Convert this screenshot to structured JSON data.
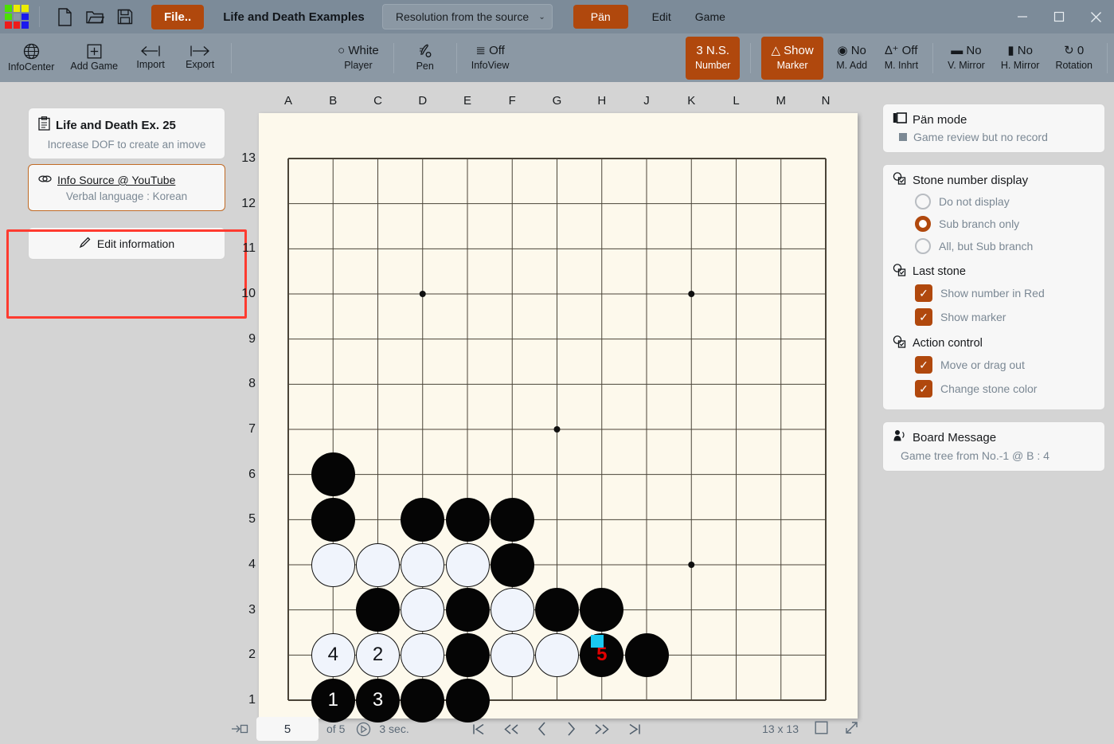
{
  "titlebar": {
    "new_icon": "new-file-icon",
    "open_icon": "open-folder-icon",
    "save_icon": "save-disk-icon",
    "file_button": "File..",
    "app_title": "Life and Death Examples",
    "collection_value": "Resolution from the source",
    "collection_arrow": "⌄",
    "mode_button": "Pän",
    "menu_edit": "Edit",
    "menu_game": "Game",
    "minimize": "–",
    "maximize": "☐",
    "close": "✕",
    "logo_colors": [
      "#4ce000",
      "#ecec00",
      "#ecec00",
      "#4ce000",
      "#8b98a4",
      "#1a1aee",
      "#ee1a1a",
      "#ee1a1a",
      "#1a1aee"
    ]
  },
  "ribbon": {
    "items": [
      {
        "glyph": "⊕",
        "label": "InfoCenter",
        "name": "infocenter"
      },
      {
        "glyph": "⊞",
        "label": "Add Game",
        "name": "add-game"
      },
      {
        "glyph": "⟵",
        "label": "Import",
        "name": "import"
      },
      {
        "glyph": "⟶",
        "label": "Export",
        "name": "export"
      }
    ],
    "mid_items": [
      {
        "glyph": "○ White",
        "label": "Player",
        "name": "white-player"
      },
      {
        "glyph": "✐",
        "label": "Pen",
        "name": "pen"
      },
      {
        "glyph": "≣ Off",
        "label": "InfoView",
        "name": "infoview"
      }
    ],
    "right_items": [
      {
        "glyph": "3 N.S.",
        "label": "Number",
        "name": "ns-number",
        "active": true
      },
      {
        "glyph": "△ Show",
        "label": "Marker",
        "name": "show-marker",
        "active": true
      },
      {
        "glyph": "◉ No",
        "label": "M. Add",
        "name": "m-add",
        "active": false
      },
      {
        "glyph": "∆⁺ Off",
        "label": "M. Inhrt",
        "name": "m-inhrt",
        "active": false
      },
      {
        "glyph": "▬ No",
        "label": "V. Mirror",
        "name": "v-mirror",
        "active": false
      },
      {
        "glyph": "▮ No",
        "label": "H. Mirror",
        "name": "h-mirror",
        "active": false
      },
      {
        "glyph": "↻ 0",
        "label": "Rotation",
        "name": "rotation",
        "active": false
      }
    ]
  },
  "left_panel": {
    "info_card": {
      "icon": "clipboard-icon",
      "title": "Life and Death Ex. 25",
      "subtitle": "Increase DOF to create an imove"
    },
    "source_card": {
      "icon": "link-icon",
      "link_text": "Info Source @ YouTube",
      "sub_text": "Verbal language : Korean"
    },
    "edit_card": {
      "icon": "pencil-icon",
      "label": "Edit information"
    }
  },
  "right_panel": {
    "mode_card": {
      "icon": "layers-icon",
      "title": "Pän mode",
      "note": "Game review but no record"
    },
    "stone_number": {
      "icon": "stone-settings-icon",
      "title": "Stone number display",
      "options": [
        {
          "label": "Do not display",
          "selected": false
        },
        {
          "label": "Sub branch only",
          "selected": true
        },
        {
          "label": "All, but Sub branch",
          "selected": false
        }
      ]
    },
    "last_stone": {
      "icon": "stone-settings-icon",
      "title": "Last stone",
      "options": [
        {
          "label": "Show number in Red",
          "checked": true
        },
        {
          "label": "Show marker",
          "checked": true
        }
      ]
    },
    "action_control": {
      "icon": "stone-settings-icon",
      "title": "Action control",
      "options": [
        {
          "label": "Move or drag out",
          "checked": true
        },
        {
          "label": "Change stone color",
          "checked": true
        }
      ]
    },
    "board_message": {
      "icon": "speaker-icon",
      "title": "Board Message",
      "message": "Game tree from No.-1 @ B : 4"
    }
  },
  "bottom_bar": {
    "jump_icon": "jump-to-move-icon",
    "move_value": "5",
    "of_label": "of 5",
    "autoplay_icon": "autoplay-icon",
    "speed_label": "3 sec.",
    "nav": [
      {
        "glyph": "|◁",
        "name": "first-move"
      },
      {
        "glyph": "◁◁",
        "name": "back-10"
      },
      {
        "glyph": "‹",
        "name": "prev-move"
      },
      {
        "glyph": "›",
        "name": "next-move"
      },
      {
        "glyph": "▷▷",
        "name": "forward-10"
      },
      {
        "glyph": "▷|",
        "name": "last-move"
      }
    ],
    "size_label": "13 x 13",
    "square_icon": "board-square-icon",
    "expand_icon": "expand-icon"
  },
  "board": {
    "size": 13,
    "col_labels": [
      "A",
      "B",
      "C",
      "D",
      "E",
      "F",
      "G",
      "H",
      "J",
      "K",
      "L",
      "M",
      "N"
    ],
    "row_labels": [
      13,
      12,
      11,
      10,
      9,
      8,
      7,
      6,
      5,
      4,
      3,
      2,
      1
    ],
    "star_points": [
      {
        "col": "D",
        "row": 10
      },
      {
        "col": "K",
        "row": 10
      },
      {
        "col": "G",
        "row": 7
      },
      {
        "col": "K",
        "row": 4
      }
    ],
    "bg_color": "#fdf9ec",
    "marker_color": "#19c8f0",
    "red_number_color": "#e00000",
    "stones": [
      {
        "col": "B",
        "row": 6,
        "color": "black"
      },
      {
        "col": "B",
        "row": 5,
        "color": "black"
      },
      {
        "col": "D",
        "row": 5,
        "color": "black"
      },
      {
        "col": "E",
        "row": 5,
        "color": "black"
      },
      {
        "col": "F",
        "row": 5,
        "color": "black"
      },
      {
        "col": "B",
        "row": 4,
        "color": "white"
      },
      {
        "col": "C",
        "row": 4,
        "color": "white"
      },
      {
        "col": "D",
        "row": 4,
        "color": "white"
      },
      {
        "col": "E",
        "row": 4,
        "color": "white"
      },
      {
        "col": "F",
        "row": 4,
        "color": "black"
      },
      {
        "col": "C",
        "row": 3,
        "color": "black"
      },
      {
        "col": "D",
        "row": 3,
        "color": "white"
      },
      {
        "col": "E",
        "row": 3,
        "color": "black"
      },
      {
        "col": "F",
        "row": 3,
        "color": "white"
      },
      {
        "col": "G",
        "row": 3,
        "color": "black"
      },
      {
        "col": "H",
        "row": 3,
        "color": "black"
      },
      {
        "col": "B",
        "row": 2,
        "color": "white",
        "number": "4"
      },
      {
        "col": "C",
        "row": 2,
        "color": "white",
        "number": "2"
      },
      {
        "col": "D",
        "row": 2,
        "color": "white"
      },
      {
        "col": "E",
        "row": 2,
        "color": "black"
      },
      {
        "col": "F",
        "row": 2,
        "color": "white"
      },
      {
        "col": "G",
        "row": 2,
        "color": "white"
      },
      {
        "col": "H",
        "row": 2,
        "color": "black",
        "number": "5",
        "red": true,
        "marker": true
      },
      {
        "col": "J",
        "row": 2,
        "color": "black"
      },
      {
        "col": "B",
        "row": 1,
        "color": "black",
        "number": "1"
      },
      {
        "col": "C",
        "row": 1,
        "color": "black",
        "number": "3"
      },
      {
        "col": "D",
        "row": 1,
        "color": "black"
      },
      {
        "col": "E",
        "row": 1,
        "color": "black"
      }
    ]
  }
}
